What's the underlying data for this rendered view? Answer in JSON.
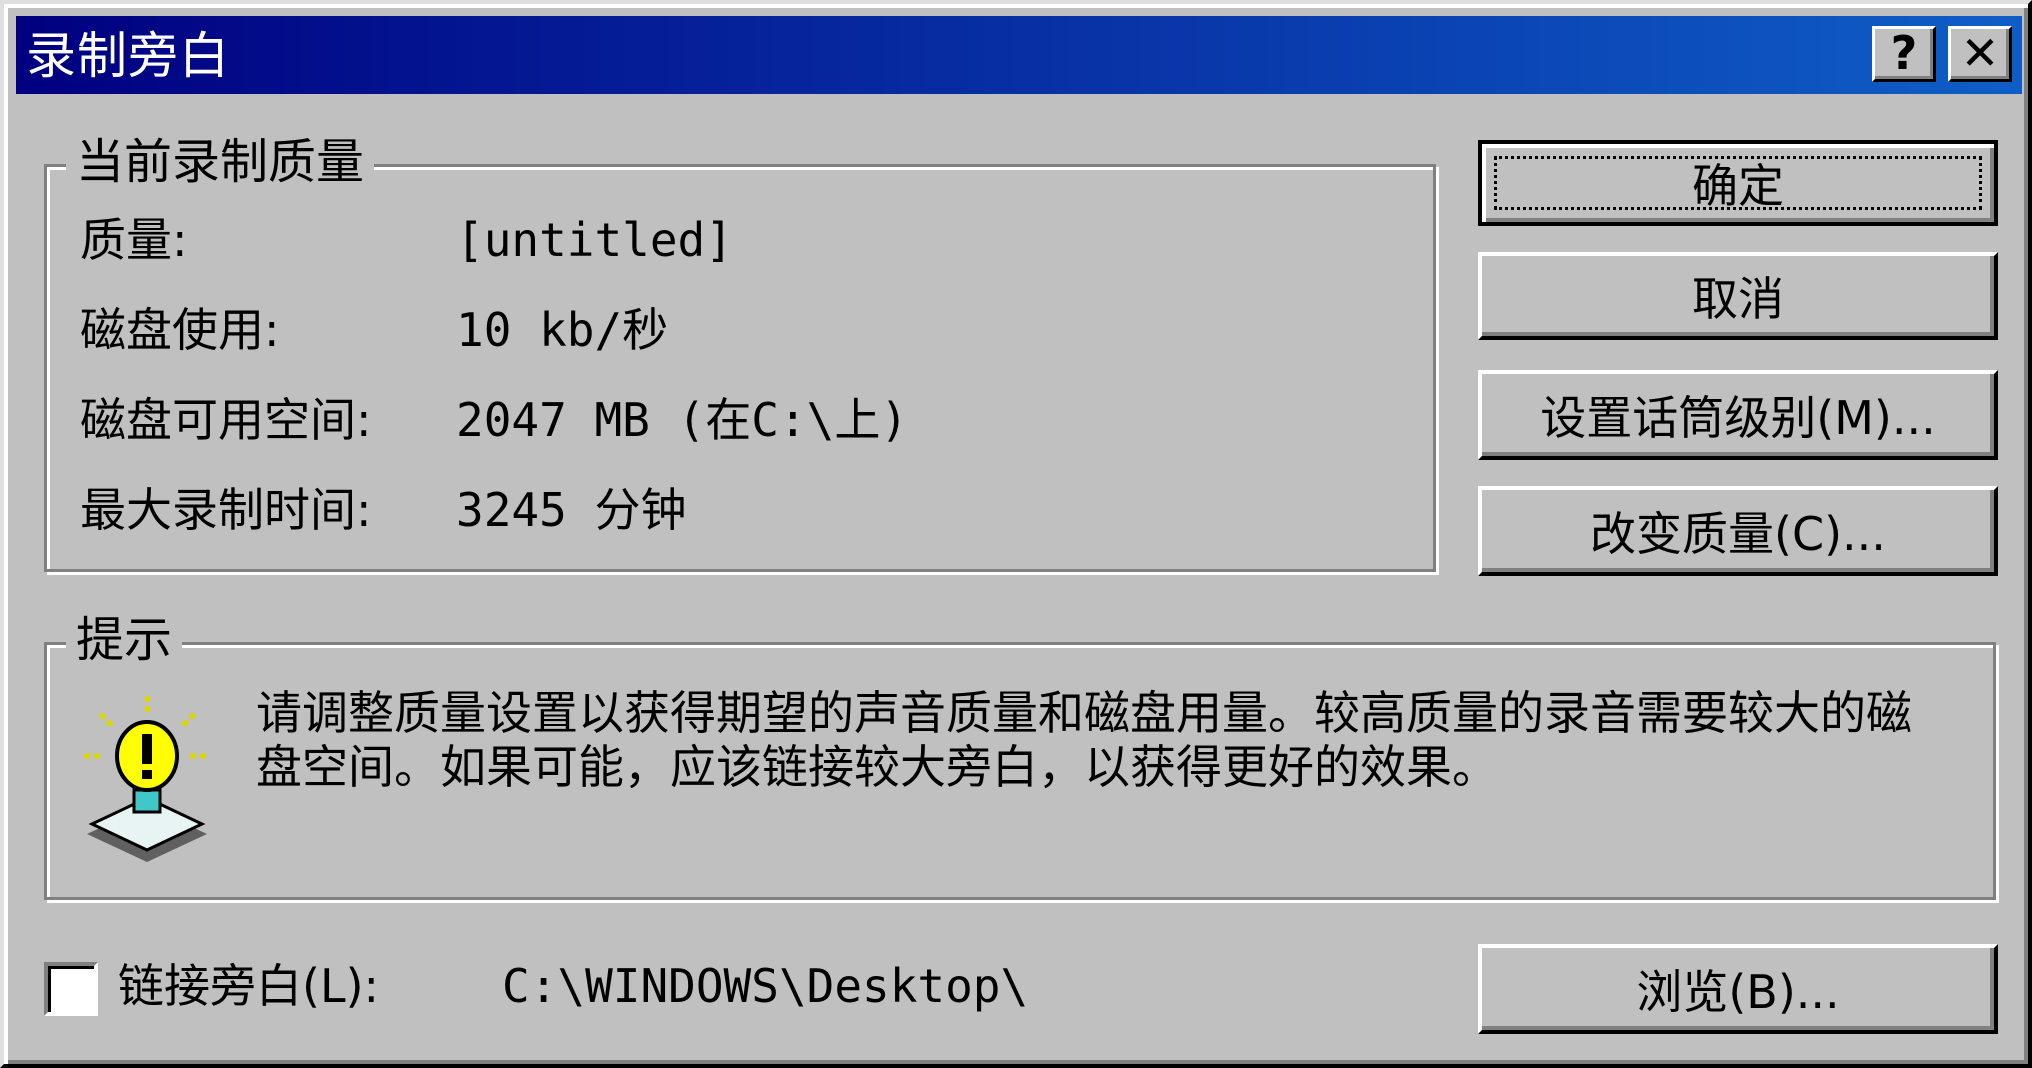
{
  "window": {
    "title": "录制旁白",
    "help_button": "?",
    "close_button": "✕"
  },
  "quality_group": {
    "legend": "当前录制质量",
    "rows": [
      {
        "label": "质量:",
        "value": "[untitled]"
      },
      {
        "label": "磁盘使用:",
        "value": "10 kb/秒"
      },
      {
        "label": "磁盘可用空间:",
        "value": "2047 MB (在C:\\上)"
      },
      {
        "label": "最大录制时间:",
        "value": "3245 分钟"
      }
    ]
  },
  "buttons": {
    "ok": "确定",
    "cancel": "取消",
    "mic_level": "设置话筒级别(M)...",
    "change_quality": "改变质量(C)...",
    "browse": "浏览(B)..."
  },
  "tip_group": {
    "legend": "提示",
    "icon": "lightbulb-icon",
    "text": "请调整质量设置以获得期望的声音质量和磁盘用量。较高质量的录音需要较大的磁盘空间。如果可能，应该链接较大旁白，以获得更好的效果。"
  },
  "link": {
    "checkbox_label": "链接旁白(L):",
    "path": "C:\\WINDOWS\\Desktop\\",
    "checked": false
  },
  "colors": {
    "title_gradient_start": "#000080",
    "title_gradient_end": "#0f5ec8",
    "face": "#c0c0c0"
  }
}
